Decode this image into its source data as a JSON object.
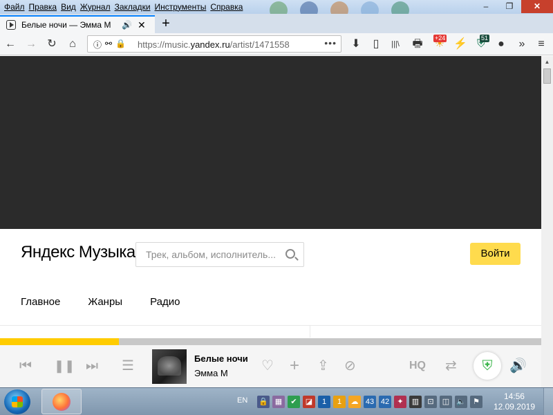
{
  "menu": [
    "Файл",
    "Правка",
    "Вид",
    "Журнал",
    "Закладки",
    "Инструменты",
    "Справка"
  ],
  "window_controls": {
    "minimize": "–",
    "maximize": "❐",
    "close": "✕"
  },
  "tab": {
    "title": "Белые ночи — Эмма М",
    "sound": "🔊",
    "close": "✕"
  },
  "newtab": "+",
  "nav": {
    "back": "←",
    "forward": "→",
    "reload": "↻",
    "home": "⌂"
  },
  "url": {
    "prefix": "https://music.",
    "domain": "yandex.ru",
    "path": "/artist/1471558",
    "dots": "•••"
  },
  "toolbar": {
    "download": "⬇",
    "reader": "▯",
    "library": "|||\\",
    "print": "🖶",
    "weather_badge": "+24",
    "bookmark_badge": "51",
    "overflow": "»",
    "menu": "≡"
  },
  "page": {
    "logo_ya": "Яндекс",
    "logo_music": "Музыка",
    "search_placeholder": "Трек, альбом, исполнитель...",
    "login": "Войти",
    "nav": [
      "Главное",
      "Жанры",
      "Радио"
    ]
  },
  "player": {
    "progress_fraction": 0.22,
    "prev": "⏮",
    "pause": "❚❚",
    "next": "⏭",
    "queue": "☰",
    "track_title": "Белые ночи",
    "track_artist": "Эмма М",
    "like": "♡",
    "add": "+",
    "share": "⇪",
    "block": "⊘",
    "hq": "HQ",
    "shuffle": "⇄",
    "volume": "🔊"
  },
  "taskbar": {
    "language": "EN",
    "tray": [
      "🔒",
      "▦",
      "✔",
      "◪",
      "1",
      "1",
      "☁",
      "43",
      "42",
      "✦",
      "▥",
      "⊡",
      "◫",
      "🔈",
      "⚑"
    ],
    "time": "14:56",
    "date": "12.09.2019"
  },
  "colors": {
    "accent": "#ffdb4d",
    "progress": "#ffcc00",
    "ad_bg": "#2b2b2b",
    "tab_accent": "#0a84ff"
  }
}
